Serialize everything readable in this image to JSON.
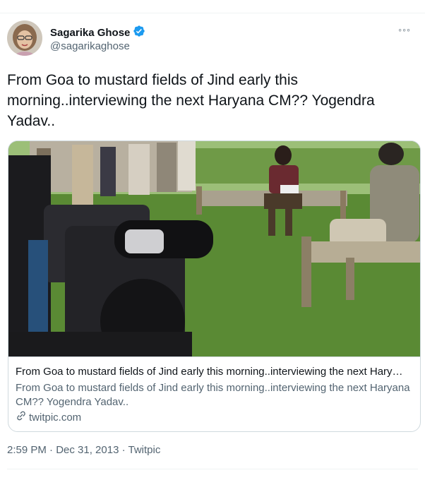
{
  "tweet": {
    "author_name": "Sagarika Ghose",
    "author_handle": "@sagarikaghose",
    "text": "From Goa to mustard fields of Jind early this morning..interviewing the next Haryana CM?? Yogendra Yadav..",
    "more_label": "◦◦◦",
    "timestamp": "2:59 PM · Dec 31, 2013 · Twitpic"
  },
  "card": {
    "title": "From Goa to mustard fields of Jind early this morning..interviewing the next Hary…",
    "description": "From Goa to mustard fields of Jind early this morning..interviewing the next Haryana CM?? Yogendra Yadav..",
    "domain": "twitpic.com"
  },
  "icons": {
    "verified": "verified-badge-icon",
    "link": "link-icon",
    "more": "more-icon"
  },
  "colors": {
    "verified": "#1d9bf0",
    "secondary_text": "#536471",
    "border": "#cfd9de"
  }
}
